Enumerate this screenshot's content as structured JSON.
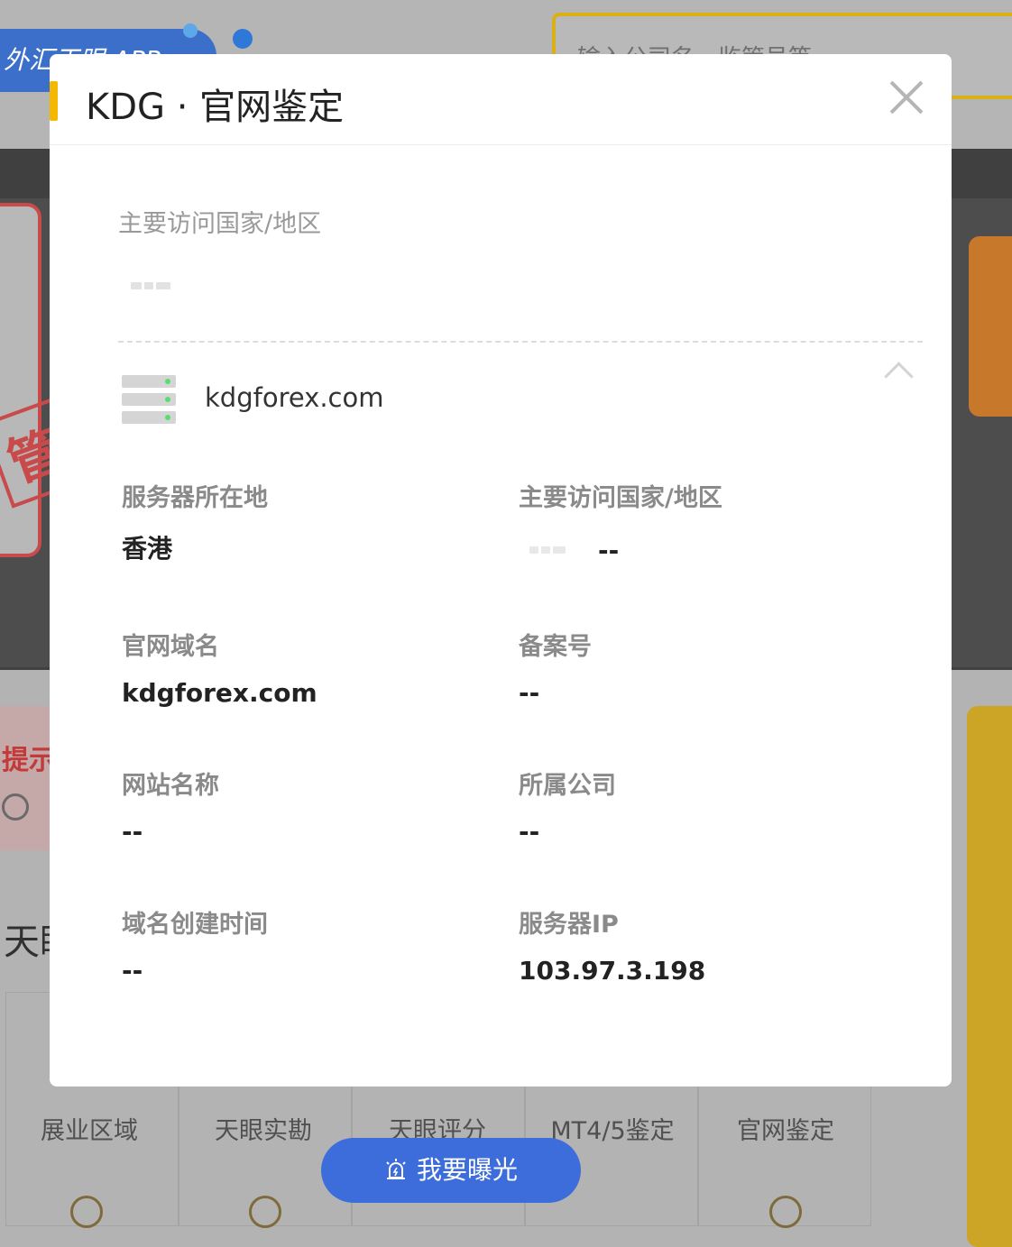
{
  "background": {
    "app_banner_text": "外汇天眼 APP",
    "search_placeholder": "输入公司名、监管号等",
    "tip_text": "提示",
    "tian_text": "天眼",
    "grid_labels": [
      "展业区域",
      "天眼实勘",
      "天眼评分",
      "MT4/5鉴定",
      "官网鉴定"
    ]
  },
  "modal": {
    "title": "KDG · 官网鉴定",
    "section_label": "主要访问国家/地区",
    "domain": "kdgforex.com",
    "fields": {
      "server_location": {
        "label": "服务器所在地",
        "value": "香港"
      },
      "main_country": {
        "label": "主要访问国家/地区",
        "value": "--"
      },
      "website_domain": {
        "label": "官网域名",
        "value": "kdgforex.com"
      },
      "icp_number": {
        "label": "备案号",
        "value": "--"
      },
      "website_name": {
        "label": "网站名称",
        "value": "--"
      },
      "company": {
        "label": "所属公司",
        "value": "--"
      },
      "domain_created": {
        "label": "域名创建时间",
        "value": "--"
      },
      "server_ip": {
        "label": "服务器IP",
        "value": "103.97.3.198"
      }
    }
  },
  "expose_button": {
    "label": "我要曝光"
  },
  "colors": {
    "accent_yellow": "#f5b800",
    "button_blue": "#3d6cdb",
    "server_led": "#55e06e"
  }
}
